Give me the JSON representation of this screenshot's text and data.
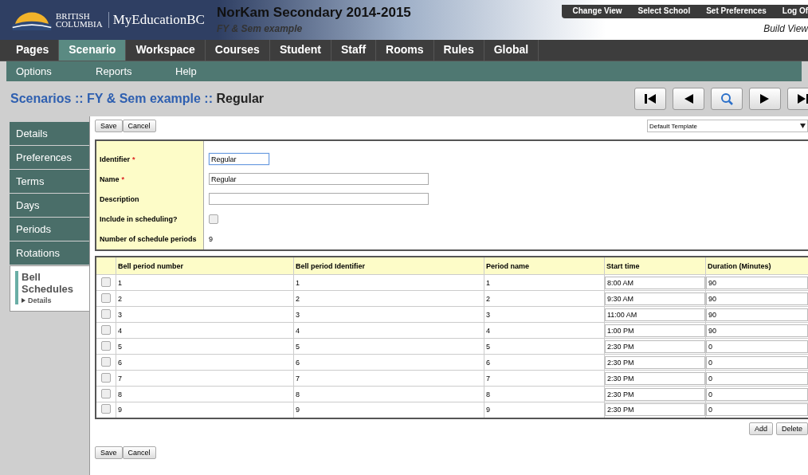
{
  "header": {
    "logo_line1": "BRITISH",
    "logo_line2": "COLUMBIA",
    "brand": "MyEducationBC",
    "title": "NorKam Secondary 2014-2015",
    "subtitle": "FY & Sem example",
    "links": [
      "Change View",
      "Select School",
      "Set Preferences",
      "Log Of"
    ],
    "view": "Build View"
  },
  "tabs": [
    {
      "label": "Pages",
      "selected": false
    },
    {
      "label": "Scenario",
      "selected": true
    },
    {
      "label": "Workspace",
      "selected": false
    },
    {
      "label": "Courses",
      "selected": false
    },
    {
      "label": "Student",
      "selected": false
    },
    {
      "label": "Staff",
      "selected": false
    },
    {
      "label": "Rooms",
      "selected": false
    },
    {
      "label": "Rules",
      "selected": false
    },
    {
      "label": "Global",
      "selected": false
    }
  ],
  "submenu": [
    "Options",
    "Reports",
    "Help"
  ],
  "breadcrumb": [
    {
      "text": "Scenarios",
      "kind": "link"
    },
    {
      "text": " :: ",
      "kind": "sep"
    },
    {
      "text": "FY & Sem example",
      "kind": "link"
    },
    {
      "text": " :: ",
      "kind": "sep"
    },
    {
      "text": "Regular",
      "kind": "current"
    }
  ],
  "side_tabs": [
    {
      "label": "Details",
      "selected": false
    },
    {
      "label": "Preferences",
      "selected": false
    },
    {
      "label": "Terms",
      "selected": false
    },
    {
      "label": "Days",
      "selected": false
    },
    {
      "label": "Periods",
      "selected": false
    },
    {
      "label": "Rotations",
      "selected": false
    },
    {
      "label": "Bell Schedules",
      "selected": true,
      "sub": "Details"
    }
  ],
  "top_buttons": [
    "Save",
    "Cancel"
  ],
  "template": "Default Template",
  "form": [
    {
      "label": "Identifier",
      "required_mark": "*",
      "kind": "input",
      "value": "Regular",
      "focused": true
    },
    {
      "label": "Name",
      "required_mark": "*",
      "kind": "wide",
      "value": "Regular",
      "focused": false
    },
    {
      "label": "Description",
      "kind": "wide",
      "focused": false
    },
    {
      "label": "Include in scheduling?",
      "kind": "checkbox",
      "checked": false
    },
    {
      "label": "Number of schedule periods",
      "kind": "text",
      "value": "9"
    }
  ],
  "table": {
    "columns": [
      "Bell period number",
      "Bell period Identifier",
      "Period name",
      "Start time",
      "Duration (Minutes)"
    ],
    "rows": [
      {
        "checked": false,
        "cells": [
          "1",
          "1",
          "1",
          "8:00 AM",
          "90"
        ]
      },
      {
        "checked": false,
        "cells": [
          "2",
          "2",
          "2",
          "9:30 AM",
          "90"
        ]
      },
      {
        "checked": false,
        "cells": [
          "3",
          "3",
          "3",
          "11:00 AM",
          "90"
        ]
      },
      {
        "checked": false,
        "cells": [
          "4",
          "4",
          "4",
          "1:00 PM",
          "90"
        ]
      },
      {
        "checked": false,
        "cells": [
          "5",
          "5",
          "5",
          "2:30 PM",
          "0"
        ]
      },
      {
        "checked": false,
        "cells": [
          "6",
          "6",
          "6",
          "2:30 PM",
          "0"
        ]
      },
      {
        "checked": false,
        "cells": [
          "7",
          "7",
          "7",
          "2:30 PM",
          "0"
        ]
      },
      {
        "checked": false,
        "cells": [
          "8",
          "8",
          "8",
          "2:30 PM",
          "0"
        ]
      },
      {
        "checked": false,
        "cells": [
          "9",
          "9",
          "9",
          "2:30 PM",
          "0"
        ]
      }
    ]
  },
  "table_buttons": [
    "Add",
    "Delete"
  ],
  "bottom_buttons": [
    "Save",
    "Cancel"
  ]
}
